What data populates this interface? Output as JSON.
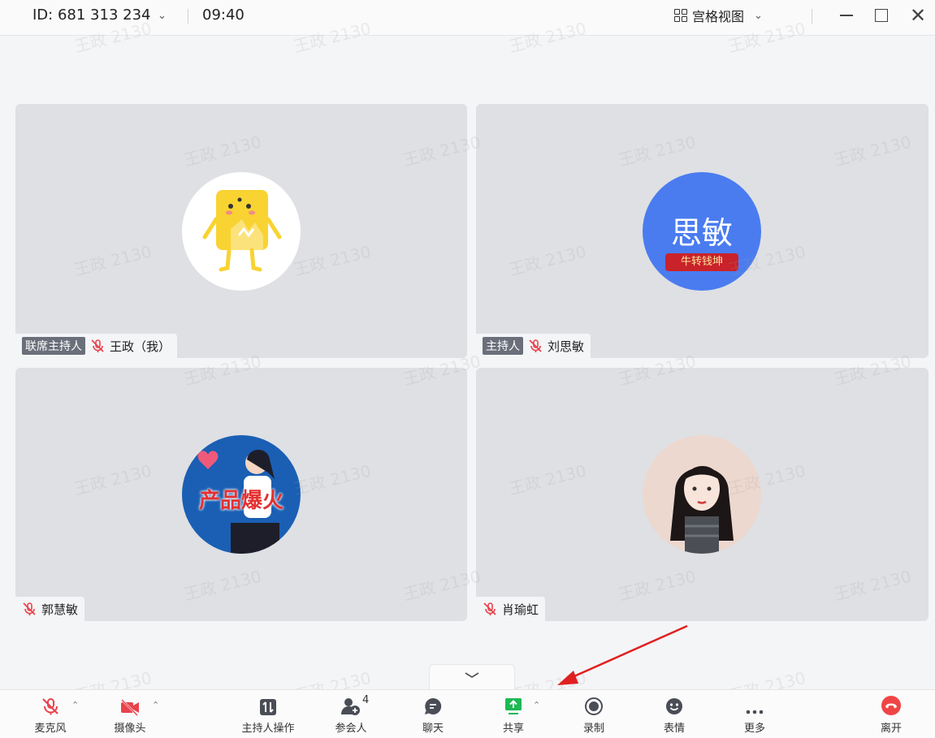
{
  "titlebar": {
    "meeting_id": "ID: 681 313 234",
    "time": "09:40",
    "view_mode": "宫格视图"
  },
  "participants": [
    {
      "role": "联席主持人",
      "name": "王政（我）",
      "muted": true,
      "avatar": "yellow-cartoon-avatar"
    },
    {
      "role": "主持人",
      "name": "刘思敏",
      "muted": true,
      "avatar_text": "思敏",
      "avatar_banner": "牛转钱坤"
    },
    {
      "role": "",
      "name": "郭慧敏",
      "muted": true,
      "avatar_text": "产品爆火"
    },
    {
      "role": "",
      "name": "肖瑜虹",
      "muted": true,
      "avatar": "girl-illustration-avatar"
    }
  ],
  "watermark": "王政 2130",
  "toolbar": {
    "mic_label": "麦克风",
    "camera_label": "摄像头",
    "host_ops_label": "主持人操作",
    "participants_label": "参会人",
    "participants_count": "4",
    "chat_label": "聊天",
    "share_label": "共享",
    "record_label": "录制",
    "reaction_label": "表情",
    "more_label": "更多",
    "leave_label": "离开"
  },
  "colors": {
    "muted_red": "#e8434c",
    "share_green": "#1db954",
    "leave_red": "#f04545",
    "avatar_blue": "#4a7cf0",
    "annotation_red": "#e02020"
  }
}
